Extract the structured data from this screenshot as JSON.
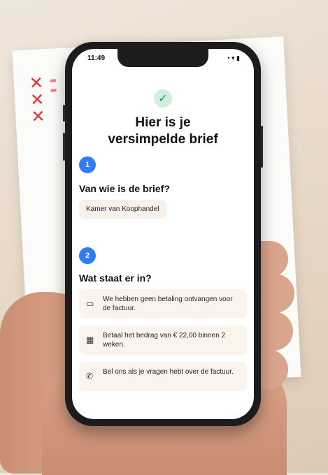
{
  "letter": {
    "mark_symbol": "✕"
  },
  "phone": {
    "status": {
      "time": "11:49",
      "icons": "• ▾ ▮"
    },
    "check_symbol": "✓",
    "title_line1": "Hier is je",
    "title_line2": "versimpelde brief",
    "section1": {
      "number": "1",
      "heading": "Van wie is de brief?",
      "sender": "Kamer van Koophandel"
    },
    "section2": {
      "number": "2",
      "heading": "Wat staat er in?",
      "items": [
        {
          "icon": "card-icon",
          "glyph": "▭",
          "text": "We hebben geen betaling ontvangen voor de factuur."
        },
        {
          "icon": "calendar-icon",
          "glyph": "▦",
          "text": "Betaal het bedrag van € 22,00 binnen 2 weken."
        },
        {
          "icon": "phone-icon",
          "glyph": "✆",
          "text": "Bel ons als je vragen hebt over de factuur."
        }
      ]
    }
  }
}
